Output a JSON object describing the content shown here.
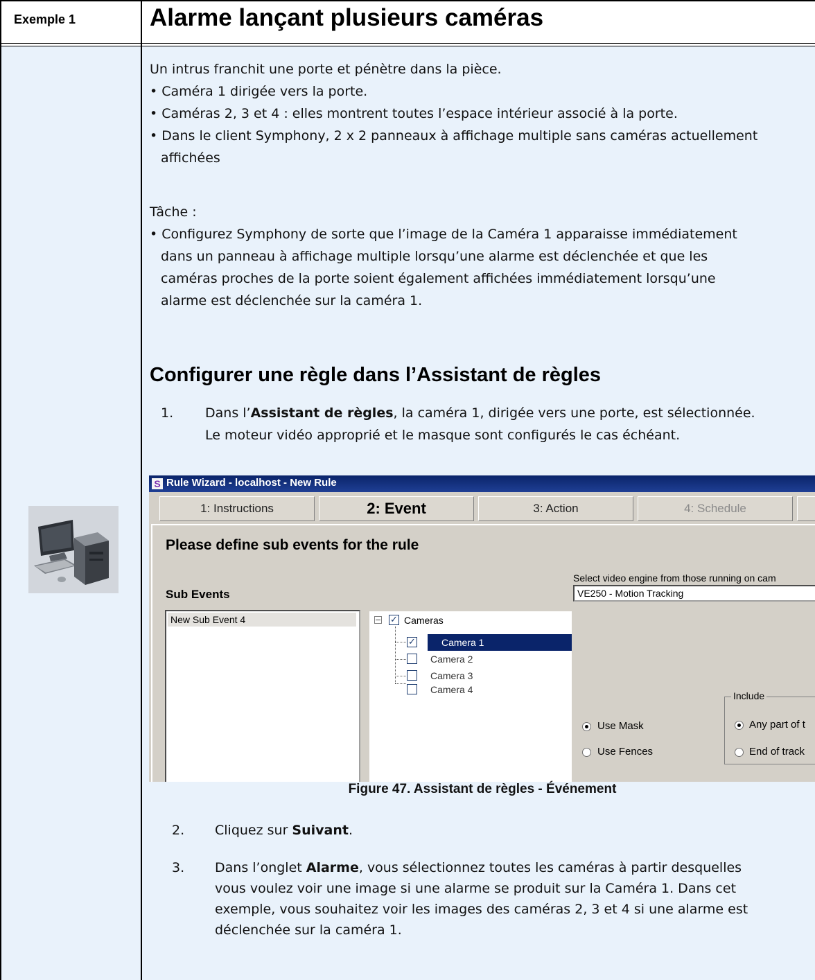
{
  "header": {
    "example_label": "Exemple 1",
    "title": "Alarme lançant plusieurs caméras"
  },
  "intro": {
    "line1": "Un intrus franchit une porte et pénètre dans la pièce.",
    "bullet1": "• Caméra 1 dirigée vers la porte.",
    "bullet2": "• Caméras 2, 3 et 4 : elles montrent toutes l’espace intérieur associé à la porte.",
    "bullet3a": "• Dans le client Symphony, 2 x 2 panneaux à affichage multiple sans caméras actuellement",
    "bullet3b": "affichées"
  },
  "task": {
    "label": "Tâche :",
    "line1": "• Configurez Symphony de sorte que l’image de la Caméra 1 apparaisse immédiatement",
    "line2": "dans un panneau à affichage multiple lorsqu’une alarme est déclenchée et que les",
    "line3": "caméras proches de la porte soient également affichées immédiatement lorsqu’une",
    "line4": "alarme est déclenchée sur la caméra 1."
  },
  "section": {
    "title": "Configurer une règle dans l’Assistant de règles"
  },
  "steps": {
    "s1_num": "1.",
    "s1_pre": "Dans l’",
    "s1_bold": "Assistant de règles",
    "s1_post": ", la caméra 1, dirigée vers une porte, est sélectionnée.",
    "s1_line2": "Le moteur vidéo approprié et le masque sont configurés le cas échéant.",
    "s2_num": "2.",
    "s2_pre": "Cliquez sur ",
    "s2_bold": "Suivant",
    "s2_post": ".",
    "s3_num": "3.",
    "s3_pre": "Dans l’onglet ",
    "s3_bold": "Alarme",
    "s3_post": ", vous sélectionnez toutes les caméras à partir desquelles",
    "s3_line2": "vous voulez voir une image si une alarme se produit sur la Caméra 1. Dans cet",
    "s3_line3": "exemple, vous souhaitez voir les images des caméras 2, 3 et 4 si une alarme est",
    "s3_line4": "déclenchée sur la caméra 1."
  },
  "screenshot": {
    "window_title": "Rule Wizard - localhost - New Rule",
    "app_icon_letter": "S",
    "tabs": [
      "1: Instructions",
      "2: Event",
      "3: Action",
      "4: Schedule"
    ],
    "heading": "Please define sub events for the rule",
    "sub_events_label": "Sub Events",
    "sub_event_item": "New Sub Event 4",
    "tree_root": "Cameras",
    "cameras": [
      "Camera 1",
      "Camera 2",
      "Camera 3",
      "Camera 4"
    ],
    "ve_label": "Select video engine from those running on cam",
    "ve_value": "VE250 - Motion Tracking",
    "use_mask": "Use Mask",
    "use_fences": "Use Fences",
    "include_label": "Include",
    "any_part": "Any part of t",
    "end_of_track": "End of track"
  },
  "caption": "Figure 47. Assistant de règles - Événement",
  "colors": {
    "body_bg": "#e9f2fb",
    "titlebar": "#0a246a",
    "selection": "#0a246a"
  }
}
